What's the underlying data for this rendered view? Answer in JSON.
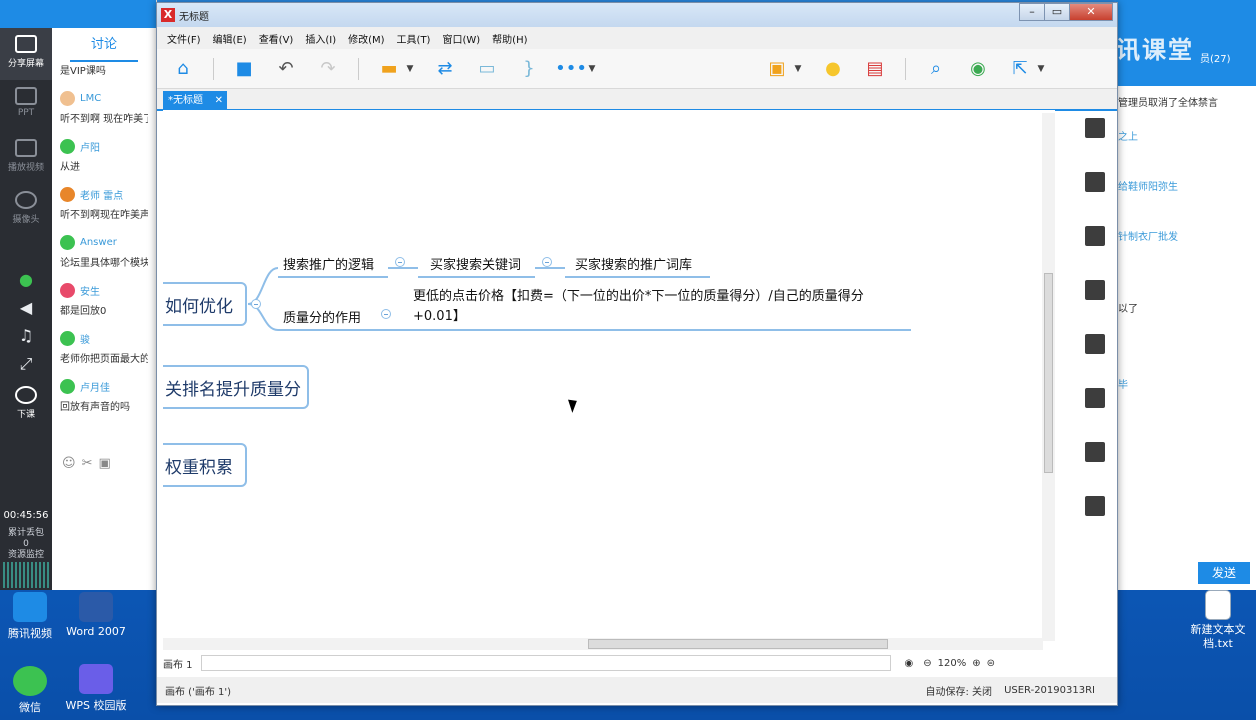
{
  "desktop": {
    "icons": [
      {
        "name": "tencent-video",
        "label": "腾讯视频"
      },
      {
        "name": "word2007",
        "label": "Word 2007"
      },
      {
        "name": "wechat",
        "label": "微信"
      },
      {
        "name": "wps",
        "label": "WPS 校园版"
      },
      {
        "name": "new-text",
        "label": "新建文本文档.txt"
      }
    ]
  },
  "classroom": {
    "items": [
      "分享屏幕",
      "PPT",
      "播放视频",
      "摄像头"
    ],
    "end_class": "下课",
    "timer": "00:45:56",
    "drop_label": "累计丢包",
    "drop_value": "0",
    "monitor": "资源监控"
  },
  "discussion": {
    "tab": "讨论",
    "messages": [
      {
        "who": "",
        "text": "是VIP课吗"
      },
      {
        "who": "LMC",
        "text": "听不到啊 现在咋美了"
      },
      {
        "who": "卢阳",
        "text": "从进"
      },
      {
        "who": "老师 雷点",
        "text": "听不到啊现在咋美声"
      },
      {
        "who": "Answer",
        "text": "论坛里具体哪个模块"
      },
      {
        "who": "安生",
        "text": "都是回放0"
      },
      {
        "who": "骏",
        "text": "老师你把页面最大的"
      },
      {
        "who": "卢月佳",
        "text": "回放有声音的吗"
      }
    ]
  },
  "right_panel": {
    "count": "员(27)",
    "notice": "管理员取消了全体禁言",
    "lines": [
      "之上",
      "给鞋师阳弥生",
      "针制衣厂批发",
      "以了",
      "毕"
    ],
    "send": "发送",
    "logo": "腾讯课堂"
  },
  "window": {
    "title": "无标题",
    "menus": [
      "文件(F)",
      "编辑(E)",
      "查看(V)",
      "插入(I)",
      "修改(M)",
      "工具(T)",
      "窗口(W)",
      "帮助(H)"
    ],
    "tab": "*无标题",
    "status_canvas": "画布 1",
    "zoom": "120%",
    "status_bottom": "画布 ('画布 1')",
    "autosave": "自动保存: 关闭",
    "user": "USER-20190313RI"
  },
  "mindmap": {
    "main_topics": [
      "如何优化",
      "关排名提升质量分",
      "权重积累"
    ],
    "subtopics": [
      "搜索推广的逻辑",
      "买家搜索关键词",
      "买家搜索的推广词库",
      "质量分的作用"
    ],
    "detail": "更低的点击价格【扣费=（下一位的出价*下一位的质量得分）/自己的质量得分+0.01】"
  },
  "colors": {
    "accent": "#1e8be5",
    "topic_border": "#8fbee8"
  }
}
